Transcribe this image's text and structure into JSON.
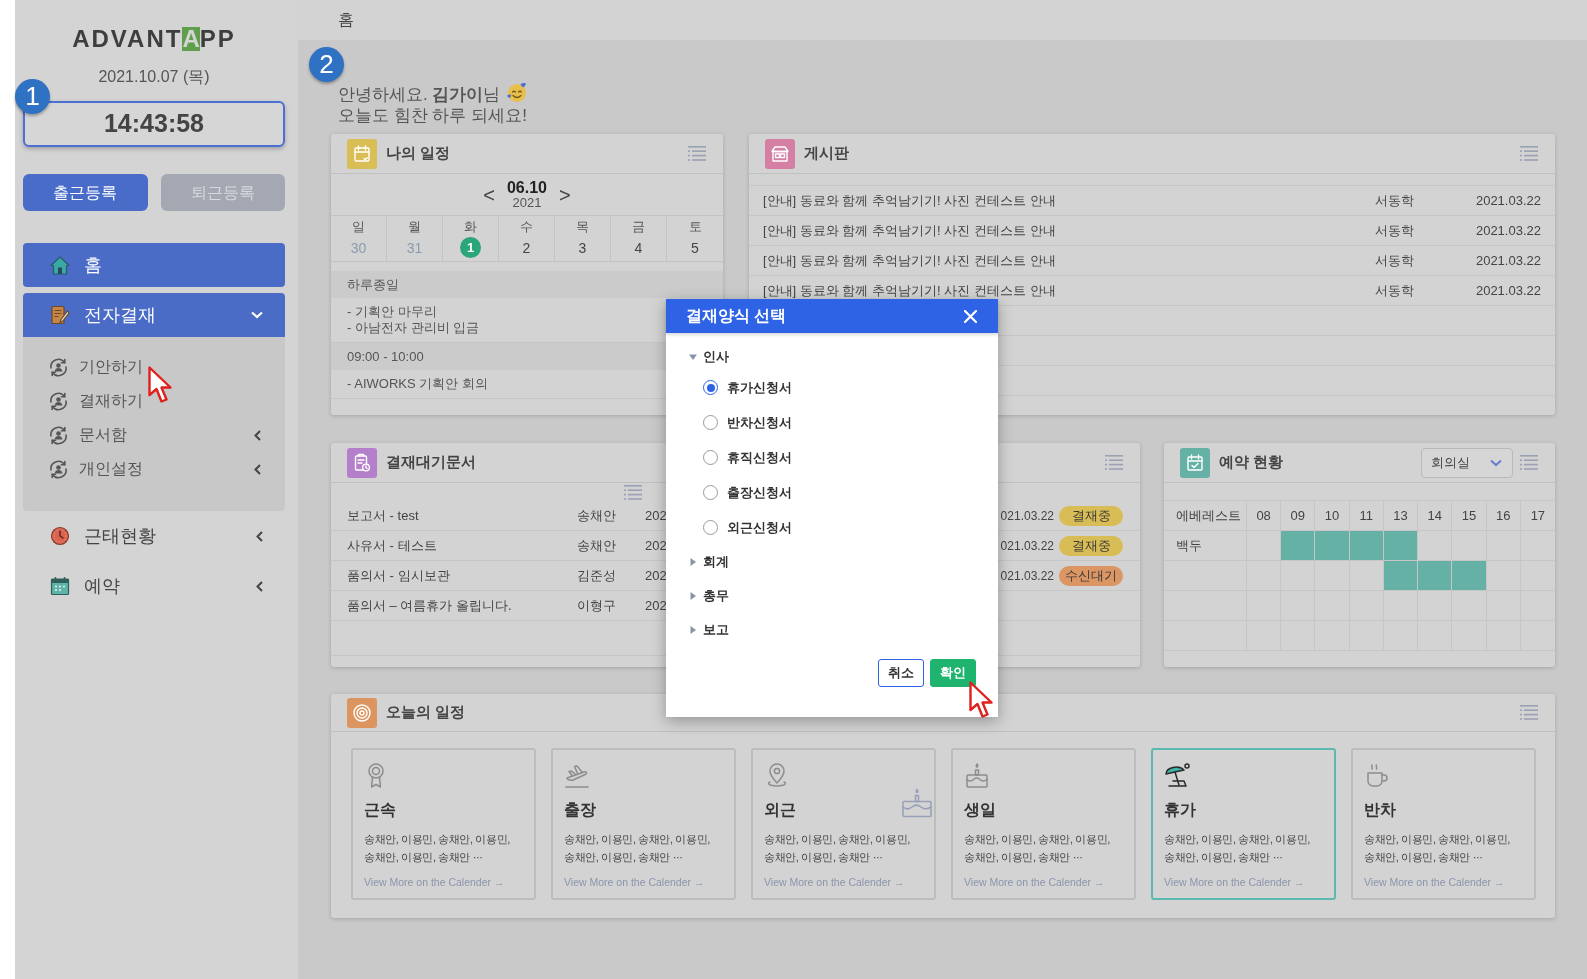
{
  "sidebar": {
    "logo": {
      "before": "ADVANT",
      "highlight": "A",
      "after": "PP"
    },
    "date": "2021.10.07 (목)",
    "step_marker": "1",
    "clock": "14:43:58",
    "buttons": [
      {
        "label": "출근등록",
        "disabled": false
      },
      {
        "label": "퇴근등록",
        "disabled": true
      }
    ],
    "menu": [
      {
        "label": "홈",
        "kind": "link",
        "selected": true
      },
      {
        "label": "전자결재",
        "kind": "group",
        "selected": true,
        "expanded": true,
        "children": [
          {
            "label": "기안하기",
            "kind": "link",
            "selected": false
          },
          {
            "label": "결재하기",
            "kind": "link",
            "selected": false
          },
          {
            "label": "문서함",
            "kind": "group",
            "selected": false,
            "expanded": false
          },
          {
            "label": "개인설정",
            "kind": "group",
            "selected": false,
            "expanded": false
          }
        ]
      },
      {
        "label": "근태현황",
        "kind": "group",
        "selected": false,
        "expanded": false
      },
      {
        "label": "예약",
        "kind": "group",
        "selected": false,
        "expanded": false
      }
    ]
  },
  "breadcrumb": "홈",
  "step_marker": "2",
  "greeting": [
    "안녕하세요. **김가이**님",
    "오늘도 힘찬 하루 되세요!"
  ],
  "schedule": {
    "title": "나의 일정",
    "prev": "<",
    "date": "06.10",
    "year": "2021",
    "next": ">",
    "days": [
      {
        "weekday": "일",
        "day": "30",
        "other_month": true,
        "selected": false
      },
      {
        "weekday": "월",
        "day": "31",
        "other_month": true,
        "selected": false
      },
      {
        "weekday": "화",
        "day": "1",
        "other_month": false,
        "selected": true
      },
      {
        "weekday": "수",
        "day": "2",
        "other_month": false,
        "selected": false
      },
      {
        "weekday": "목",
        "day": "3",
        "other_month": false,
        "selected": false
      },
      {
        "weekday": "금",
        "day": "4",
        "other_month": false,
        "selected": false
      },
      {
        "weekday": "토",
        "day": "5",
        "other_month": false,
        "selected": false
      }
    ],
    "events": [
      {
        "kind": "time",
        "text": "하루종일"
      },
      {
        "kind": "detail",
        "text": "- 기획안 마무리\n- 아남전자 관리비 입금"
      },
      {
        "kind": "time",
        "text": "09:00 - 10:00"
      },
      {
        "kind": "detail",
        "text": "- AIWORKS 기획안 회의"
      }
    ]
  },
  "board": {
    "title": "게시판",
    "rows": [
      {
        "title": "[안내] 동료와 함께 추억남기기! 사진 컨테스트 안내",
        "author": "서동학",
        "date": "2021.03.22"
      },
      {
        "title": "[안내] 동료와 함께 추억남기기! 사진 컨테스트 안내",
        "author": "서동학",
        "date": "2021.03.22"
      },
      {
        "title": "[안내] 동료와 함께 추억남기기! 사진 컨테스트 안내",
        "author": "서동학",
        "date": "2021.03.22"
      },
      {
        "title": "[안내] 동료와 함께 추억남기기! 사진 컨테스트 안내",
        "author": "서동학",
        "date": "2021.03.22"
      }
    ]
  },
  "pending": {
    "title": "결재대기문서",
    "rows": [
      {
        "title": "보고서 - test",
        "author": "송채안",
        "column_3": "202",
        "column_4": "021.03.22",
        "status": {
          "label": "결재중",
          "color": "#d8bd56"
        }
      },
      {
        "title": "사유서 - 테스트",
        "author": "송채안",
        "column_3": "202",
        "column_4": "021.03.22",
        "status": {
          "label": "결재중",
          "color": "#d8bd56"
        }
      },
      {
        "title": "품의서 - 임시보관",
        "author": "김준성",
        "column_3": "202",
        "column_4": "021.03.22",
        "status": {
          "label": "수신대기",
          "color": "#dc9663"
        }
      },
      {
        "title": "품의서 – 여름휴가 올립니다.",
        "author": "이형구",
        "column_3": "202"
      }
    ]
  },
  "reservation": {
    "title": "예약 현황",
    "room": "회의실",
    "header_label": "에베레스트",
    "hours": [
      "08",
      "09",
      "10",
      "11",
      "13",
      "14",
      "15",
      "16",
      "17"
    ],
    "rows": [
      {
        "label": "백두",
        "booked": [
          false,
          true,
          true,
          true,
          true,
          false,
          false,
          false,
          false
        ]
      },
      {
        "booked": [
          false,
          false,
          false,
          false,
          true,
          true,
          true,
          false,
          false
        ]
      },
      {
        "booked": [
          false,
          false,
          false,
          false,
          false,
          false,
          false,
          false,
          false
        ]
      },
      {
        "booked": [
          false,
          false,
          false,
          false,
          false,
          false,
          false,
          false,
          false
        ]
      }
    ]
  },
  "today": {
    "title": "오늘의 일정",
    "items": [
      {
        "title": "근속",
        "names": "송채안, 이용민, 송채안, 이용민,\n송채안, 이용민, 송채안 ···",
        "link": "View More on the Calender →",
        "selected": false
      },
      {
        "title": "출장",
        "names": "송채안, 이용민, 송채안, 이용민,\n송채안, 이용민, 송채안 ···",
        "link": "View More on the Calender →",
        "selected": false
      },
      {
        "title": "외근",
        "names": "송채안, 이용민, 송채안, 이용민,\n송채안, 이용민, 송채안 ···",
        "link": "View More on the Calender →",
        "selected": false
      },
      {
        "title": "생일",
        "names": "송채안, 이용민, 송채안, 이용민,\n송채안, 이용민, 송채안 ···",
        "link": "View More on the Calender →",
        "selected": false
      },
      {
        "title": "휴가",
        "names": "송채안, 이용민, 송채안, 이용민,\n송채안, 이용민, 송채안 ···",
        "link": "View More on the Calender →",
        "selected": true
      },
      {
        "title": "반차",
        "names": "송채안, 이용민, 송채안, 이용민,\n송채안, 이용민, 송채안 ···",
        "link": "View More on the Calender →",
        "selected": false
      }
    ]
  },
  "modal": {
    "title": "결재양식 선택",
    "groups": [
      {
        "label": "인사",
        "expanded": true,
        "options": [
          {
            "label": "휴가신청서",
            "selected": true
          },
          {
            "label": "반차신청서",
            "selected": false
          },
          {
            "label": "휴직신청서",
            "selected": false
          },
          {
            "label": "출장신청서",
            "selected": false
          },
          {
            "label": "외근신청서",
            "selected": false
          }
        ]
      },
      {
        "label": "회계",
        "expanded": false
      },
      {
        "label": "총무",
        "expanded": false
      },
      {
        "label": "보고",
        "expanded": false
      }
    ],
    "buttons": [
      {
        "label": "취소",
        "kind": "secondary"
      },
      {
        "label": "확인",
        "kind": "primary"
      }
    ]
  }
}
